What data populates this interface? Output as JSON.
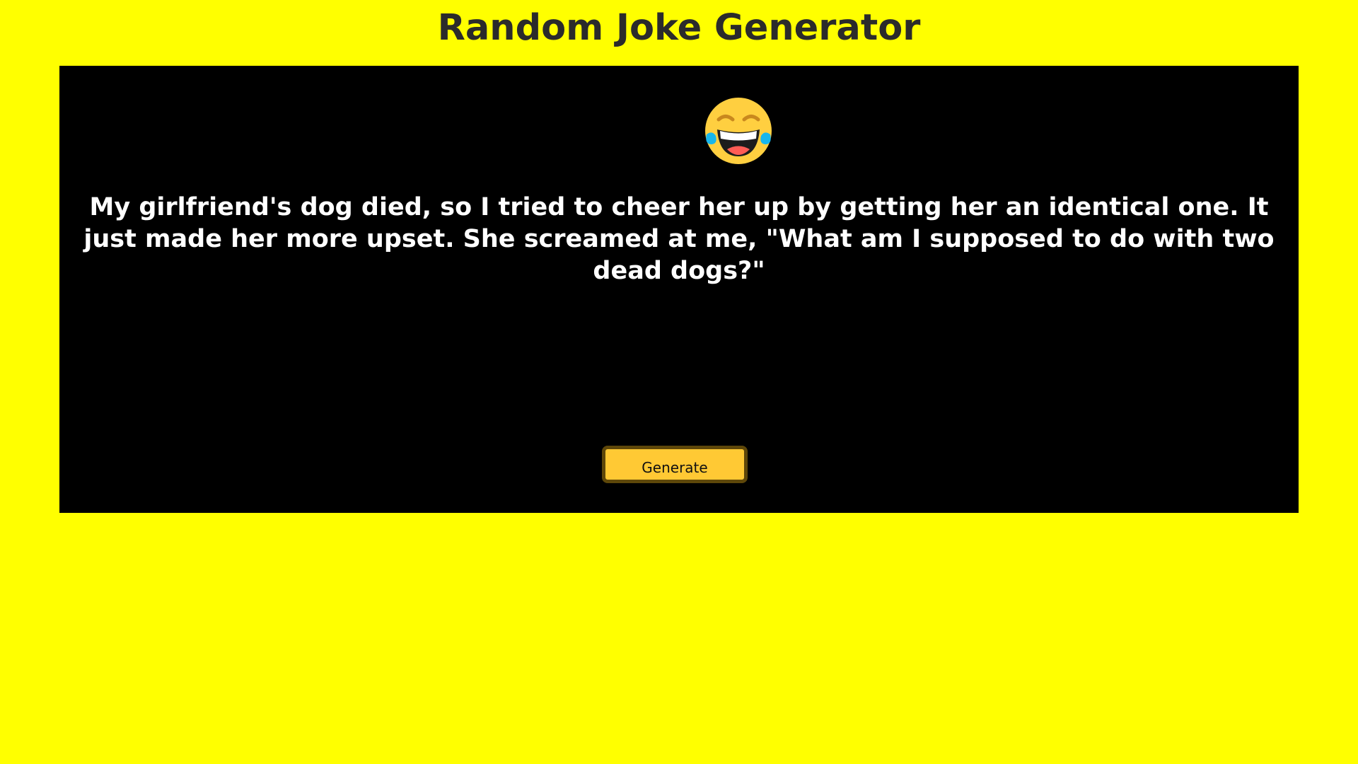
{
  "header": {
    "title": "Random Joke Generator"
  },
  "card": {
    "emoji": {
      "icon": "face-with-tears-of-joy-icon",
      "face_color": "#ffcf40",
      "tear_color": "#17b6ec"
    },
    "joke": "My girlfriend's dog died, so I tried to cheer her up by getting her an identical one. It just made her more upset. She screamed at me, \"What am I supposed to do with two dead dogs?\"",
    "generate_label": "Generate"
  },
  "colors": {
    "page_background": "#ffff00",
    "card_background": "#000000",
    "button_background": "#ffc934",
    "button_border": "#5e4709"
  }
}
